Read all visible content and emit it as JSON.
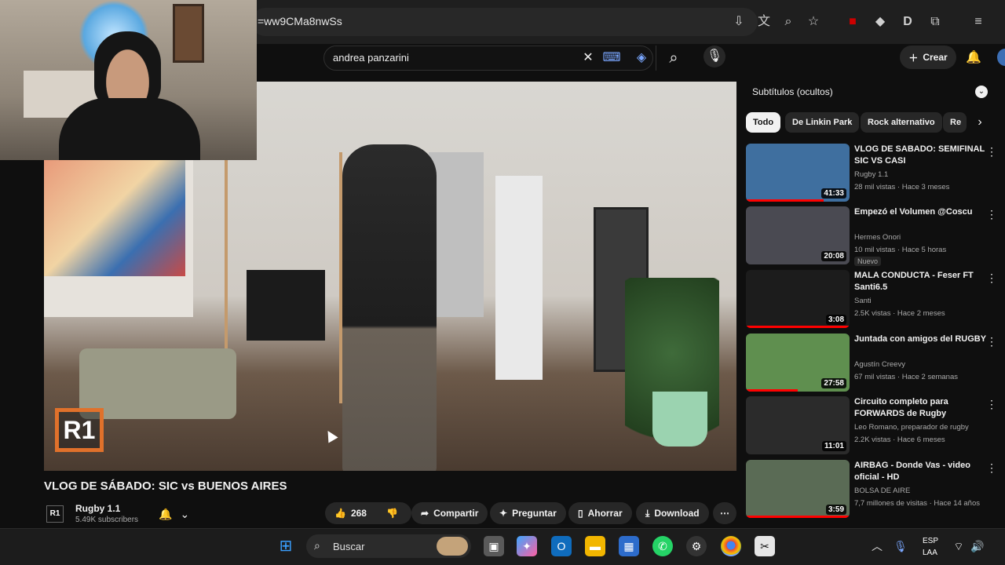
{
  "browser": {
    "url": "=ww9CMa8nwSs"
  },
  "youtube": {
    "search_value": "andrea panzarini",
    "create_label": "Crear"
  },
  "video": {
    "title": "VLOG DE SÁBADO: SIC vs BUENOS AIRES",
    "watermark": "R1",
    "channel": {
      "avatar_text": "R1",
      "name": "Rugby 1.1",
      "subscribers": "5.49K subscribers"
    },
    "actions": {
      "likes": "268",
      "share": "Compartir",
      "ask": "Preguntar",
      "save": "Ahorrar",
      "download": "Download"
    }
  },
  "sidebar": {
    "subtitles_label": "Subtítulos (ocultos)",
    "chips": [
      "Todo",
      "De Linkin Park",
      "Rock alternativo",
      "Re"
    ],
    "recommendations": [
      {
        "title": "VLOG DE SABADO: SEMIFINAL SIC VS CASI",
        "channel": "Rugby 1.1",
        "meta": "28 mil vistas · Hace 3 meses",
        "duration": "41:33",
        "watched": 0.75,
        "thumb_color": "#3f6f9f"
      },
      {
        "title": "Empezó el Volumen @Coscu",
        "channel": "Hermes Onori",
        "meta": "10 mil vistas · Hace 5 horas",
        "duration": "20:08",
        "badge": "Nuevo",
        "watched": 0,
        "thumb_color": "#4a4a52"
      },
      {
        "title": "MALA CONDUCTA - Feser FT Santi6.5",
        "channel": "Santi",
        "meta": "2.5K vistas · Hace 2 meses",
        "duration": "3:08",
        "watched": 1,
        "thumb_color": "#1c1c1c"
      },
      {
        "title": "Juntada con amigos del RUGBY",
        "channel": "Agustín Creevy",
        "meta": "67 mil vistas · Hace 2 semanas",
        "duration": "27:58",
        "watched": 0.5,
        "thumb_color": "#5f8f4f"
      },
      {
        "title": "Circuito completo para FORWARDS de Rugby (potenci...",
        "channel": "Leo Romano, preparador de rugby",
        "meta": "2.2K vistas · Hace 6 meses",
        "duration": "11:01",
        "watched": 0,
        "thumb_color": "#2b2b2b"
      },
      {
        "title": "AIRBAG - Donde Vas - video oficial - HD",
        "channel": "BOLSA DE AIRE",
        "meta": "7,7 millones de visitas · Hace 14 años",
        "duration": "3:59",
        "watched": 1,
        "thumb_color": "#5a6b55"
      }
    ]
  },
  "taskbar": {
    "search_label": "Buscar",
    "lang_top": "ESP",
    "lang_bottom": "LAA"
  }
}
